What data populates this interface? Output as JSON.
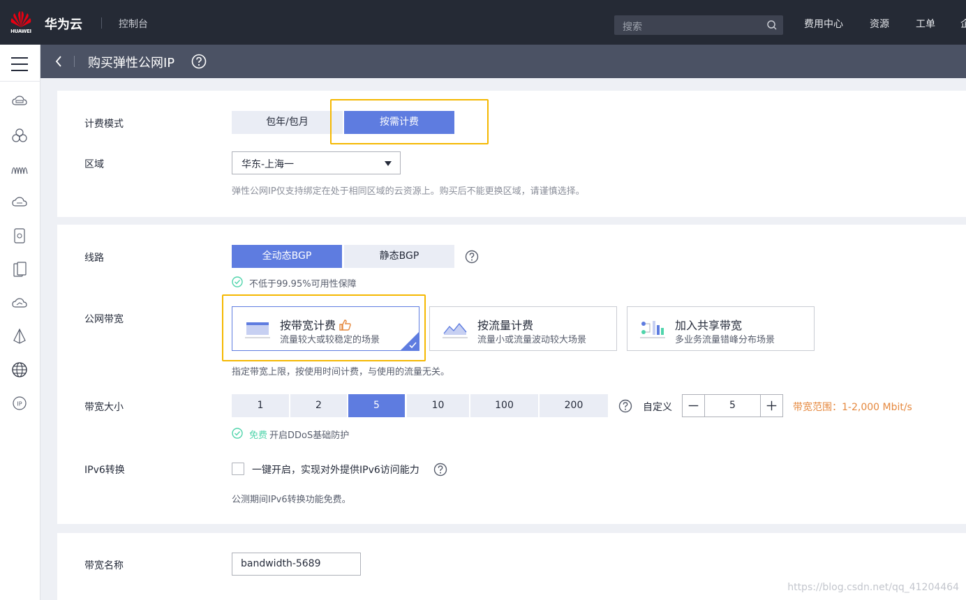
{
  "topbar": {
    "logo_text": "HUAWEI",
    "brand": "华为云",
    "console": "控制台",
    "search_placeholder": "搜索",
    "nav": [
      "费用中心",
      "资源",
      "工单",
      "企"
    ]
  },
  "sidebar": {
    "icons": [
      "cloud-server-icon",
      "cluster-icon",
      "waves-icon",
      "cloud-disk-icon",
      "storage-icon",
      "database-icon",
      "cloud-monitor-icon",
      "network-icon",
      "globe-icon",
      "ip-icon"
    ]
  },
  "subheader": {
    "title": "购买弹性公网IP"
  },
  "billing": {
    "label": "计费模式",
    "options": [
      "包年/包月",
      "按需计费"
    ],
    "selected": "按需计费"
  },
  "region": {
    "label": "区域",
    "value": "华东-上海一",
    "hint": "弹性公网IP仅支持绑定在处于相同区域的云资源上。购买后不能更换区域，请谨慎选择。"
  },
  "line": {
    "label": "线路",
    "options": [
      "全动态BGP",
      "静态BGP"
    ],
    "selected": "全动态BGP",
    "guarantee": "不低于99.95%可用性保障"
  },
  "bandwidth_type": {
    "label": "公网带宽",
    "cards": [
      {
        "title": "按带宽计费",
        "sub": "流量较大或较稳定的场景"
      },
      {
        "title": "按流量计费",
        "sub": "流量小或流量波动较大场景"
      },
      {
        "title": "加入共享带宽",
        "sub": "多业务流量错峰分布场景"
      }
    ],
    "hint": "指定带宽上限，按使用时间计费，与使用的流量无关。"
  },
  "bandwidth_size": {
    "label": "带宽大小",
    "options": [
      "1",
      "2",
      "5",
      "10",
      "100",
      "200"
    ],
    "selected": "5",
    "custom_label": "自定义",
    "value": "5",
    "range": "带宽范围：1-2,000 Mbit/s",
    "ddos_free": "免费",
    "ddos_text": "开启DDoS基础防护"
  },
  "ipv6": {
    "label": "IPv6转换",
    "checkbox_text": "一键开启，实现对外提供IPv6访问能力",
    "hint": "公测期间IPv6转换功能免费。"
  },
  "bandwidth_name": {
    "label": "带宽名称",
    "value": "bandwidth-5689"
  },
  "watermark": "https://blog.csdn.net/qq_41204464",
  "colors": {
    "primary": "#5e7ce0",
    "highlight": "#f5b800",
    "success": "#50d4ab",
    "warning": "#e5883e",
    "topbar": "#252a35"
  }
}
